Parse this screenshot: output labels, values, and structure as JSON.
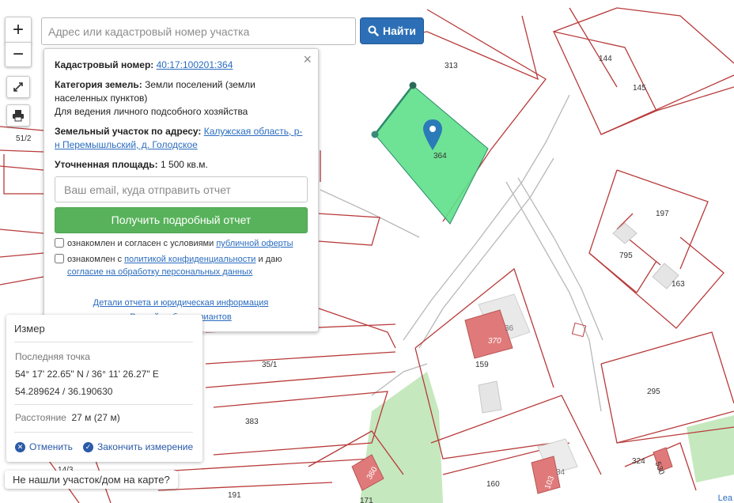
{
  "search": {
    "placeholder": "Адрес или кадастровый номер участка",
    "button_label": "Найти"
  },
  "controls": {
    "zoom_in": "+",
    "zoom_out": "−",
    "fullscreen_icon": "fullscreen-icon",
    "print_icon": "print-icon"
  },
  "popup": {
    "close_label": "×",
    "cadastral_label": "Кадастровый номер:",
    "cadastral_number": "40:17:100201:364",
    "category_label": "Категория земель:",
    "category_value": "Земли поселений (земли населенных пунктов)",
    "usage": "Для ведения личного подсобного хозяйства",
    "address_label": "Земельный участок по адресу:",
    "address_value": "Калужская область, р-н Перемышльский, д. Голодское",
    "area_label": "Уточненная площадь:",
    "area_value": "1 500 кв.м.",
    "email_placeholder": "Ваш email, куда отправить отчет",
    "report_button": "Получить подробный отчет",
    "consent1_text": "ознакомлен и согласен с условиями",
    "consent1_link": "публичной оферты",
    "consent2_text1": "ознакомлен с",
    "consent2_link1": "политикой конфиденциальности",
    "consent2_text2": "и даю",
    "consent2_link2": "согласие на обработку персональных данных",
    "details_link": "Детали отчета и юридическая информация",
    "manual_link": "Ручной выбор вариантов"
  },
  "measure": {
    "title": "Измер",
    "last_point_label": "Последняя точка",
    "dms": "54° 17' 22.65\" N / 36° 11' 26.27\" E",
    "decimal": "54.289624 / 36.190630",
    "distance_label": "Расстояние",
    "distance_value": "27 м (27 м)",
    "cancel_label": "Отменить",
    "finish_label": "Закончить измерение"
  },
  "notfound": "Не нашли участок/дом на карте?",
  "attribution": "Lea",
  "parcels": [
    "313",
    "144",
    "145",
    "364",
    "51/2",
    "197",
    "795",
    "163",
    "370",
    "36",
    "159",
    "35/1",
    "383",
    "295",
    "324",
    "530",
    "160",
    "103",
    "34",
    "360",
    "14/3",
    "191",
    "171"
  ],
  "colors": {
    "boundary": "#b83a3a",
    "selected_fill": "#5fe08a",
    "selected_border": "#2a8a6a",
    "building": "#e07a7a",
    "marker": "#2a7bb8",
    "green_area": "#c6e8be"
  }
}
